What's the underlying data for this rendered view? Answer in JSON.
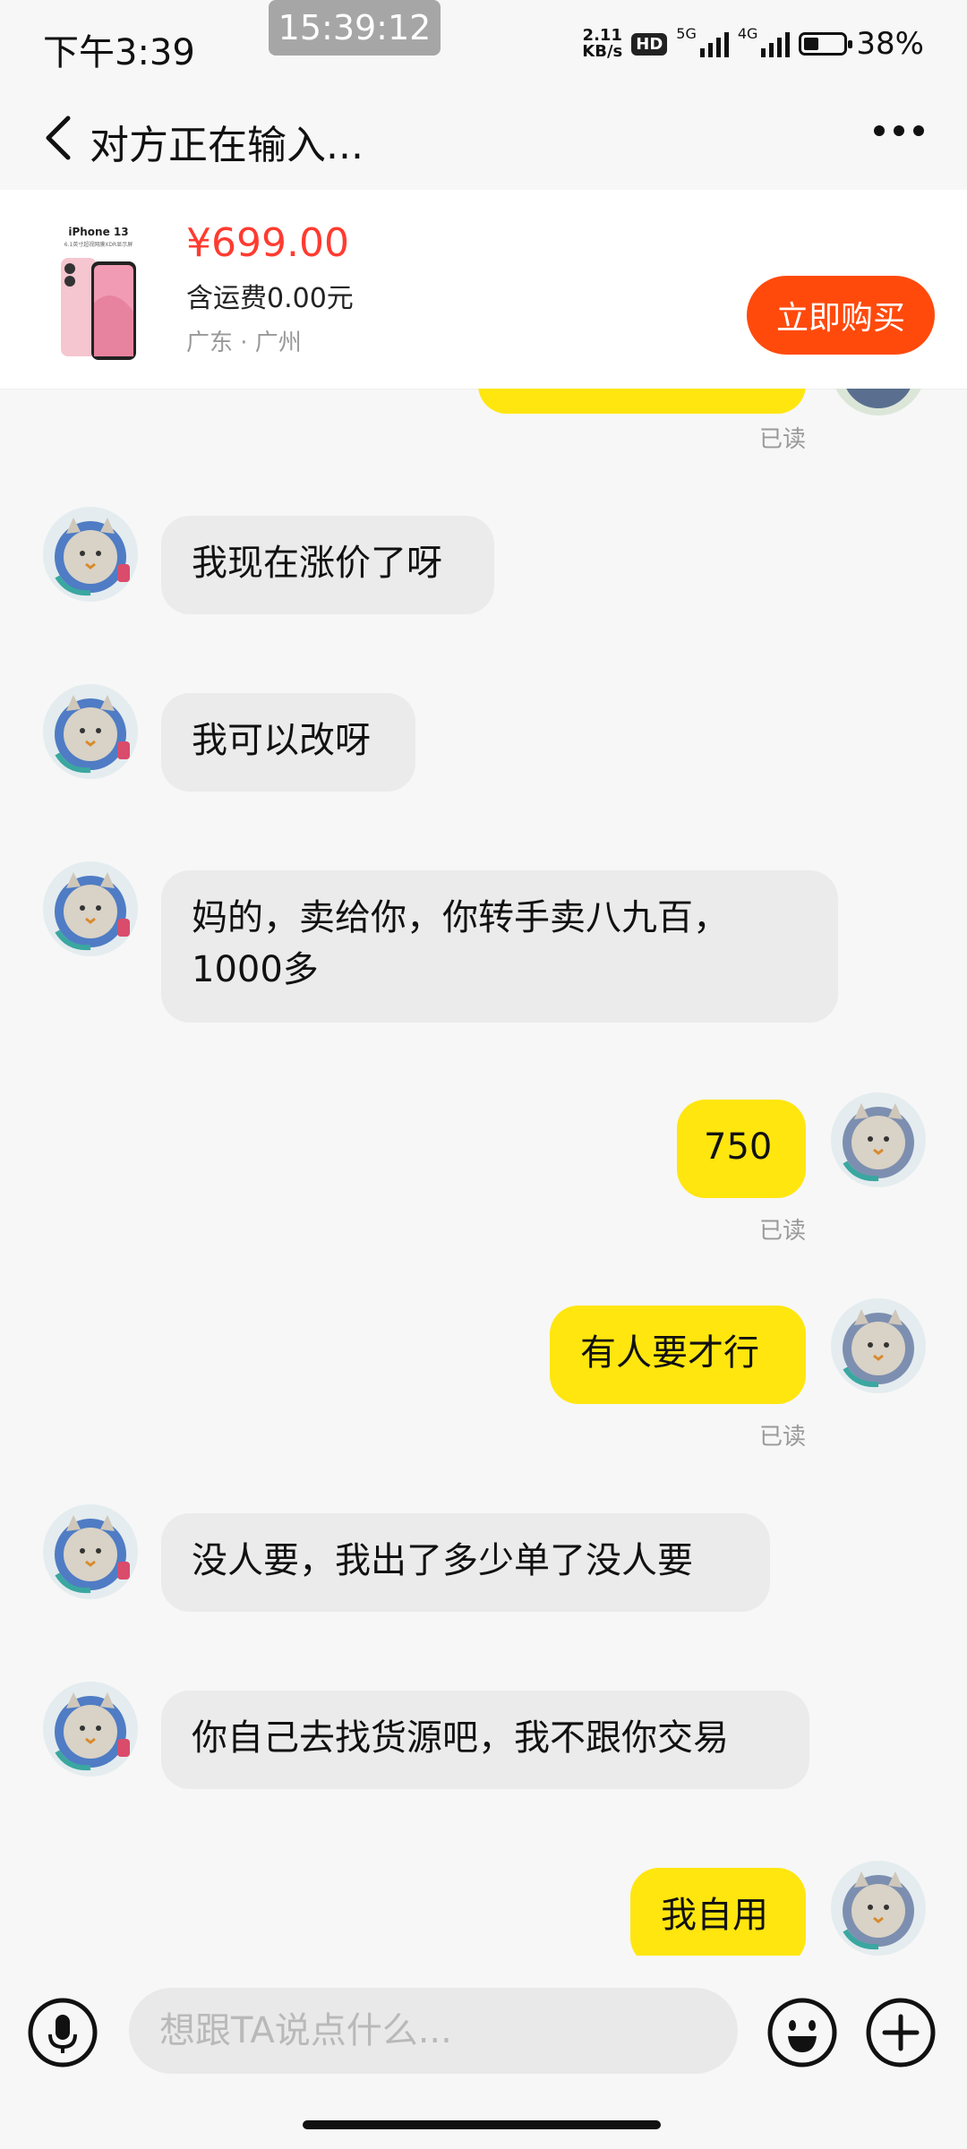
{
  "status_bar": {
    "time": "下午3:39",
    "clock": "15:39:12",
    "net_speed_value": "2.11",
    "net_speed_unit": "KB/s",
    "hd_label": "HD",
    "sim1_label": "5G",
    "sim2_label": "4G",
    "battery_percent": "38%",
    "battery_level": 0.38
  },
  "header": {
    "title": "对方正在输入...",
    "back_icon": "chevron-left-icon",
    "more_icon": "more-horizontal-icon"
  },
  "product": {
    "thumb_title": "iPhone 13",
    "thumb_subtitle": "6.1英寸超视网膜XDR显示屏",
    "price": "¥699.00",
    "shipping": "含运费0.00元",
    "location": "广东 · 广州",
    "buy_label": "立即购买",
    "price_color": "#ff3b30",
    "buy_color": "#ff4a0c"
  },
  "messages": [
    {
      "side": "right",
      "text": "",
      "read": "已读",
      "partial": true
    },
    {
      "side": "left",
      "text": "我现在涨价了呀"
    },
    {
      "side": "left",
      "text": "我可以改呀"
    },
    {
      "side": "left",
      "text": "妈的，卖给你，你转手卖八九百，1000多"
    },
    {
      "side": "right",
      "text": "750",
      "read": "已读"
    },
    {
      "side": "right",
      "text": "有人要才行",
      "read": "已读"
    },
    {
      "side": "left",
      "text": "没人要，我出了多少单了没人要"
    },
    {
      "side": "left",
      "text": "你自己去找货源吧，我不跟你交易"
    },
    {
      "side": "right",
      "text": "我自用"
    }
  ],
  "input": {
    "placeholder": "想跟TA说点什么...",
    "mic_icon": "microphone-icon",
    "emoji_icon": "emoji-icon",
    "plus_icon": "plus-icon"
  },
  "colors": {
    "bubble_right": "#ffe60f",
    "bubble_left": "#ebebeb",
    "background": "#f7f7f7"
  }
}
